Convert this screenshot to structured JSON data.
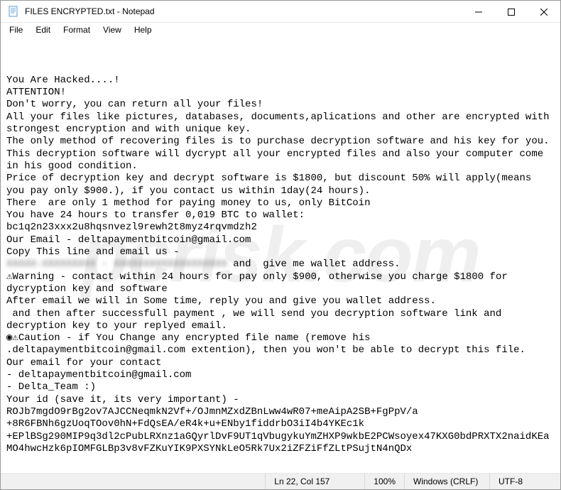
{
  "window": {
    "title": "FILES ENCRYPTED.txt - Notepad"
  },
  "menu": {
    "file": "File",
    "edit": "Edit",
    "format": "Format",
    "view": "View",
    "help": "Help"
  },
  "body": {
    "l1": "You Are Hacked....!",
    "l2": "ATTENTION!",
    "l3": "Don't worry, you can return all your files!",
    "l4": "All your files like pictures, databases, documents,aplications and other are encrypted with",
    "l5": "strongest encryption and with unique key.",
    "l6": "The only method of recovering files is to purchase decryption software and his key for you.",
    "l7": "This decryption software will dycrypt all your encrypted files and also your computer come in his good condition.",
    "l8": "Price of decryption key and decrypt software is $1800, but discount 50% will apply(means you pay only $900.), if you contact us within 1day(24 hours).",
    "l9": "There  are only 1 method for paying money to us, only BitCoin",
    "l10": "You have 24 hours to transfer 0,019 BTC to wallet:",
    "l11": "bc1q2n23xxx2u8hqsnvezl9rewh2t8myz4rqvmdzh2",
    "l12": "Our Email - deltapaymentbitcoin@gmail.com",
    "l13": "Copy This line and email us -",
    "l14a": "XXXXX-XXXXXXXXX - XXXXXXXXXXXXXXXXXXX",
    "l14b": " and  give me wallet address.",
    "l15": "⚠Warning - contact within 24 hours for pay only $900, otherwise you charge $1800 for dycryption key and software",
    "l16": "After email we will in Some time, reply you and give you wallet address.",
    "l17": " and then after successfull payment , we will send you decryption software link and decryption key to your replyed email.",
    "l18": "◉⚠Caution - if You Change any encrypted file name (remove his .deltapaymentbitcoin@gmail.com extention), then you won't be able to decrypt this file.",
    "l19": "Our email for your contact",
    "l20": "- deltapaymentbitcoin@gmail.com",
    "l21": "- Delta_Team :)",
    "l22": "Your id (save it, its very important) -",
    "l23": "ROJb7mgdO9rBg2ov7AJCCNeqmkN2Vf+/OJmnMZxdZBnLww4wR07+meAipA2SB+FgPpV/a",
    "l24": "+8R6FBNh6gzUoqTOov0hN+FdQsEA/eR4k+u+ENby1fiddrbO3iI4b4YKEc1k",
    "l25": "+EPlBSg290MIP9q3dl2cPubLRXnz1aGQyrlDvF9UT1qVbugykuYmZHXP9wkbE2PCWsoyex47KXG0bdPRXTX2naidKEaMO4hwcHzk6pIOMFGLBp3v8vFZKuYIK9PXSYNkLeO5Rk7Ux2iZFZiFfZLtPSujtN4nQDx"
  },
  "status": {
    "position": "Ln 22, Col 157",
    "zoom": "100%",
    "lineend": "Windows (CRLF)",
    "encoding": "UTF-8"
  },
  "watermark": "pcrisk.com"
}
